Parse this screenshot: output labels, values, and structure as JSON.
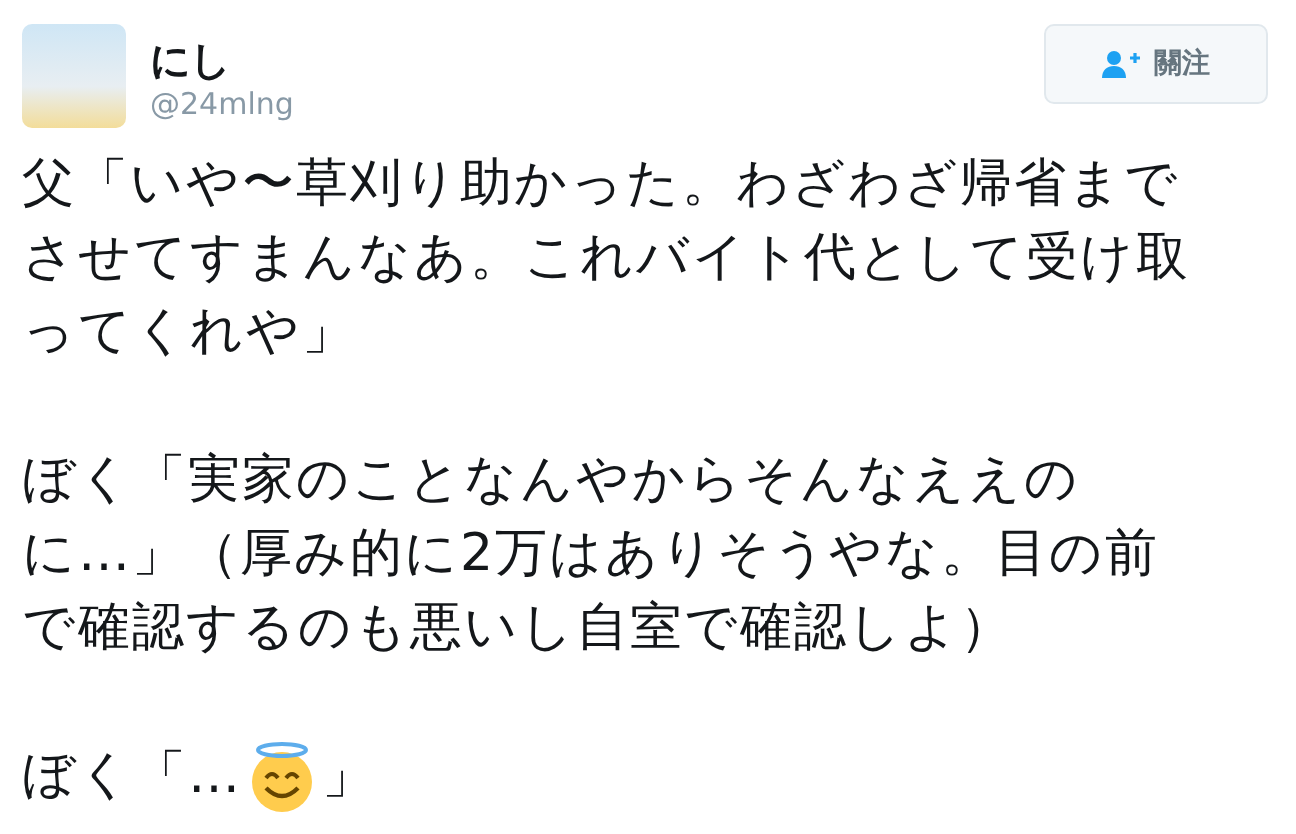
{
  "author": {
    "name": "にし",
    "handle": "@24mlng"
  },
  "follow_button": {
    "label": "關注"
  },
  "tweet": {
    "paragraphs": [
      "父「いや〜草刈り助かった。わざわざ帰省までさせてすまんなあ。これバイト代として受け取ってくれや」",
      "ぼく「実家のことなんやからそんなええのに…」（厚み的に2万はありそうやな。目の前で確認するのも悪いし自室で確認しよ）"
    ],
    "last_line": {
      "before": "ぼく「…",
      "after": "」"
    }
  }
}
